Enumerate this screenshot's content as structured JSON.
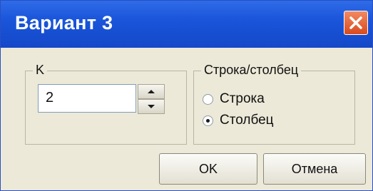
{
  "window": {
    "title": "Вариант 3",
    "close_icon": "close-icon"
  },
  "group_k": {
    "legend": "K",
    "spinner_value": "2"
  },
  "group_rc": {
    "legend": "Строка/столбец",
    "options": [
      {
        "label": "Строка",
        "selected": false
      },
      {
        "label": "Столбец",
        "selected": true
      }
    ]
  },
  "buttons": {
    "ok": "OK",
    "cancel": "Отмена"
  },
  "colors": {
    "titlebar": "#1a55da",
    "close": "#d84a1f",
    "dialog_bg": "#ece9d8"
  }
}
